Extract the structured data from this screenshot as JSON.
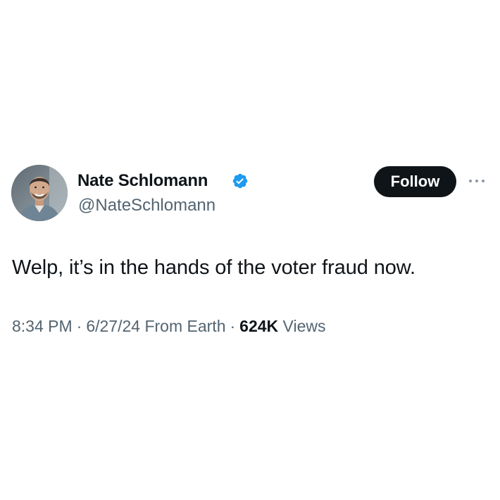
{
  "author": {
    "name": "Nate Schlomann",
    "handle": "@NateSchlomann",
    "verified_color": "#1d9bf0"
  },
  "follow_label": "Follow",
  "more_icon": "more-options-icon",
  "tweet": {
    "text": "Welp, it’s in the hands of the voter fraud now.",
    "time": "8:34 PM",
    "date": "6/27/24",
    "source": "From Earth",
    "separator": "·",
    "views_count": "624K",
    "views_label": "Views"
  },
  "colors": {
    "text": "#0f1419",
    "secondary": "#536471",
    "button_bg": "#0f1419",
    "button_text": "#ffffff"
  }
}
